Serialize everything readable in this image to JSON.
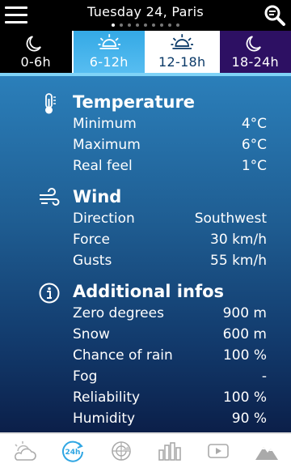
{
  "header": {
    "title": "Tuesday 24, Paris",
    "page_dots": 9,
    "active_dot": 0
  },
  "tabs": [
    {
      "label": "0-6h",
      "icon": "moon-icon"
    },
    {
      "label": "6-12h",
      "icon": "sun-icon"
    },
    {
      "label": "12-18h",
      "icon": "sun-icon"
    },
    {
      "label": "18-24h",
      "icon": "moon-icon"
    }
  ],
  "sections": {
    "temperature": {
      "title": "Temperature",
      "icon": "thermometer-icon",
      "rows": [
        {
          "label": "Minimum",
          "value": "4°C"
        },
        {
          "label": "Maximum",
          "value": "6°C"
        },
        {
          "label": "Real feel",
          "value": "1°C"
        }
      ]
    },
    "wind": {
      "title": "Wind",
      "icon": "wind-icon",
      "rows": [
        {
          "label": "Direction",
          "value": "Southwest"
        },
        {
          "label": "Force",
          "value": "30 km/h"
        },
        {
          "label": "Gusts",
          "value": "55 km/h"
        }
      ]
    },
    "additional": {
      "title": "Additional infos",
      "icon": "info-icon",
      "rows": [
        {
          "label": "Zero degrees",
          "value": "900 m"
        },
        {
          "label": "Snow",
          "value": "600 m"
        },
        {
          "label": "Chance of rain",
          "value": "100 %"
        },
        {
          "label": "Fog",
          "value": "-"
        },
        {
          "label": "Reliability",
          "value": "100 %"
        },
        {
          "label": "Humidity",
          "value": "90 %"
        }
      ]
    }
  },
  "bottom_nav": [
    {
      "icon": "cloud-sun-icon"
    },
    {
      "icon": "24h-icon"
    },
    {
      "icon": "radar-icon"
    },
    {
      "icon": "bar-chart-icon"
    },
    {
      "icon": "video-icon"
    },
    {
      "icon": "mountain-icon"
    }
  ],
  "colors": {
    "accent": "#2fa6e3",
    "night_tab": "#2d1063"
  }
}
